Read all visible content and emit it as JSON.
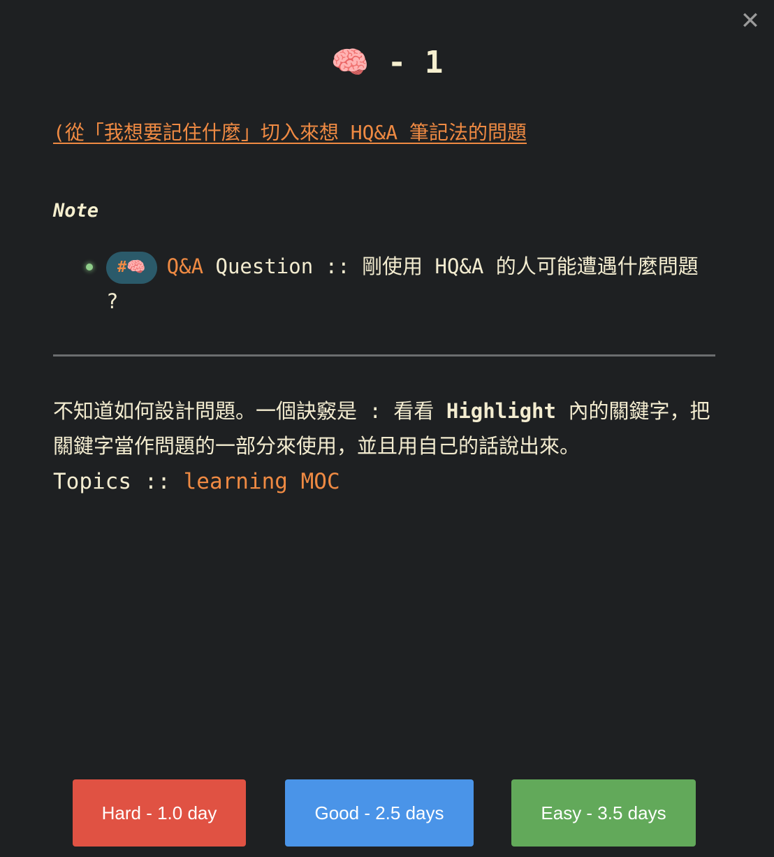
{
  "modal": {
    "close_icon": "✕",
    "title_emoji": "🧠",
    "title_rest": " - 1"
  },
  "source": {
    "link_text": "(從「我想要記住什麼」切入來想 HQ&A 筆記法的問題"
  },
  "note": {
    "heading": "Note",
    "tag_hash": "#",
    "tag_emoji": "🧠",
    "qa_label": "Q&A",
    "question_text": " Question :: 剛使用 HQ&A 的人可能遭遇什麼問題 ?"
  },
  "answer": {
    "text_before": "不知道如何設計問題。一個訣竅是 : 看看 ",
    "highlight_word": "Highlight",
    "text_after": " 內的關鍵字，把關鍵字當作問題的一部分來使用，並且用自己的話說出來。"
  },
  "topics": {
    "label": "Topics :: ",
    "link_text": "learning MOC"
  },
  "buttons": {
    "hard_label": "Hard - 1.0 day",
    "good_label": "Good - 2.5 days",
    "easy_label": "Easy - 3.5 days"
  },
  "colors": {
    "background": "#1e2022",
    "text": "#f3ecd0",
    "accent": "#ef8a43",
    "tag_bg": "#2b5a6a",
    "hard": "#e05243",
    "good": "#4a94e8",
    "easy": "#62a95a"
  }
}
